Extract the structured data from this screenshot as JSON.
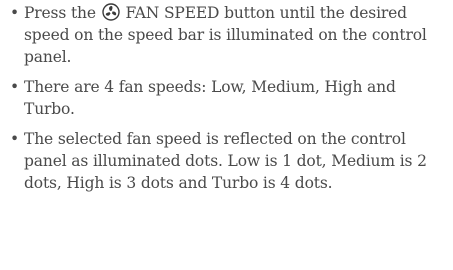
{
  "bullets": [
    {
      "prefix": "Press the",
      "icon": "fan-icon",
      "suffix": "FAN SPEED button until the desired speed on the speed bar is illuminated on the control panel."
    },
    {
      "text": "There are 4 fan speeds: Low, Medium, High and Turbo."
    },
    {
      "text": "The selected fan speed is reflected on the control panel as illuminated dots. Low is 1 dot, Medium is 2 dots, High is 3 dots and Turbo is 4 dots."
    }
  ],
  "bullet_char": "•"
}
